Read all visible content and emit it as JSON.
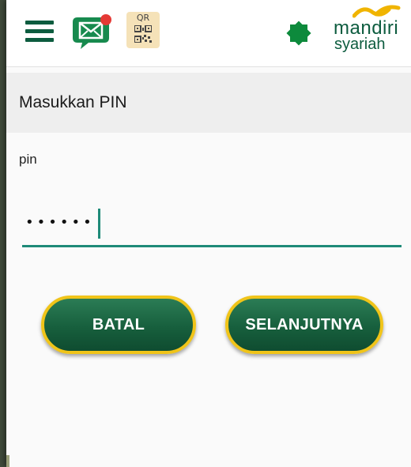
{
  "header": {
    "menu_icon": "hamburger-menu-icon",
    "message_icon": "message-envelope-icon",
    "qr_icon": "qr-code-icon",
    "qr_label": "QR",
    "brand_icon": "star-emblem-icon",
    "brand_name": "mandiri",
    "brand_sub": "syariah"
  },
  "page": {
    "title": "Masukkan PIN"
  },
  "pin": {
    "label": "pin",
    "masked_value": "••••••"
  },
  "buttons": {
    "cancel_label": "BATAL",
    "next_label": "SELANJUTNYA"
  },
  "colors": {
    "brand_green": "#0d5c3f",
    "accent_teal": "#1e8a78",
    "button_border": "#f0c419",
    "notification_red": "#e53935"
  }
}
